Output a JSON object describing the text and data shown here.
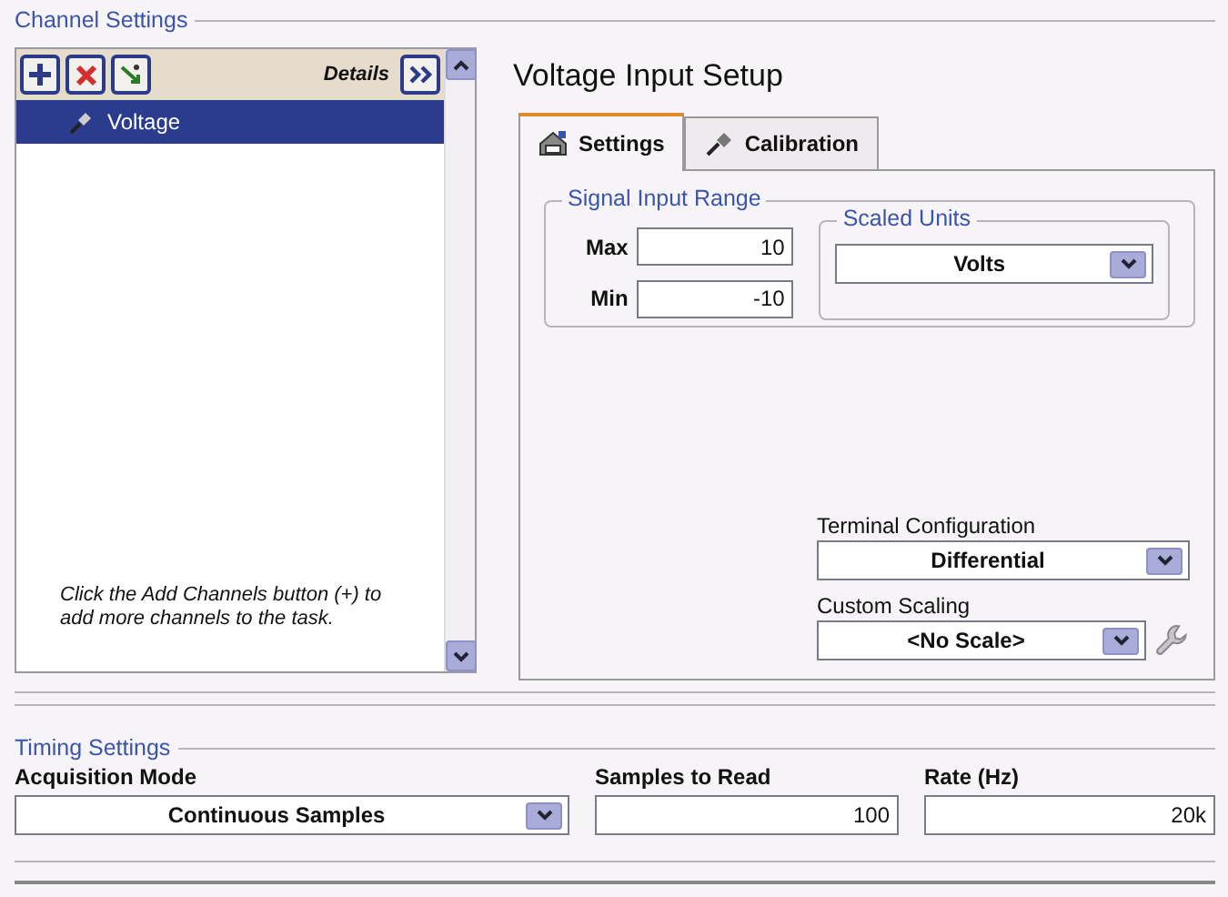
{
  "channel_settings": {
    "title": "Channel Settings",
    "details_label": "Details",
    "channels": [
      {
        "name": "Voltage",
        "selected": true
      }
    ],
    "help_text": "Click the Add Channels button (+) to add more channels to the task."
  },
  "setup": {
    "title": "Voltage Input Setup",
    "tabs": [
      {
        "label": "Settings",
        "selected": true
      },
      {
        "label": "Calibration",
        "selected": false
      }
    ],
    "signal_input_range": {
      "title": "Signal Input Range",
      "max": {
        "label": "Max",
        "value": "10"
      },
      "min": {
        "label": "Min",
        "value": "-10"
      }
    },
    "scaled_units": {
      "title": "Scaled Units",
      "value": "Volts"
    },
    "terminal_configuration": {
      "label": "Terminal Configuration",
      "value": "Differential"
    },
    "custom_scaling": {
      "label": "Custom Scaling",
      "value": "<No Scale>"
    }
  },
  "timing_settings": {
    "title": "Timing Settings",
    "acquisition_mode": {
      "label": "Acquisition Mode",
      "value": "Continuous Samples"
    },
    "samples_to_read": {
      "label": "Samples to Read",
      "value": "100"
    },
    "rate": {
      "label": "Rate (Hz)",
      "value": "20k"
    }
  }
}
